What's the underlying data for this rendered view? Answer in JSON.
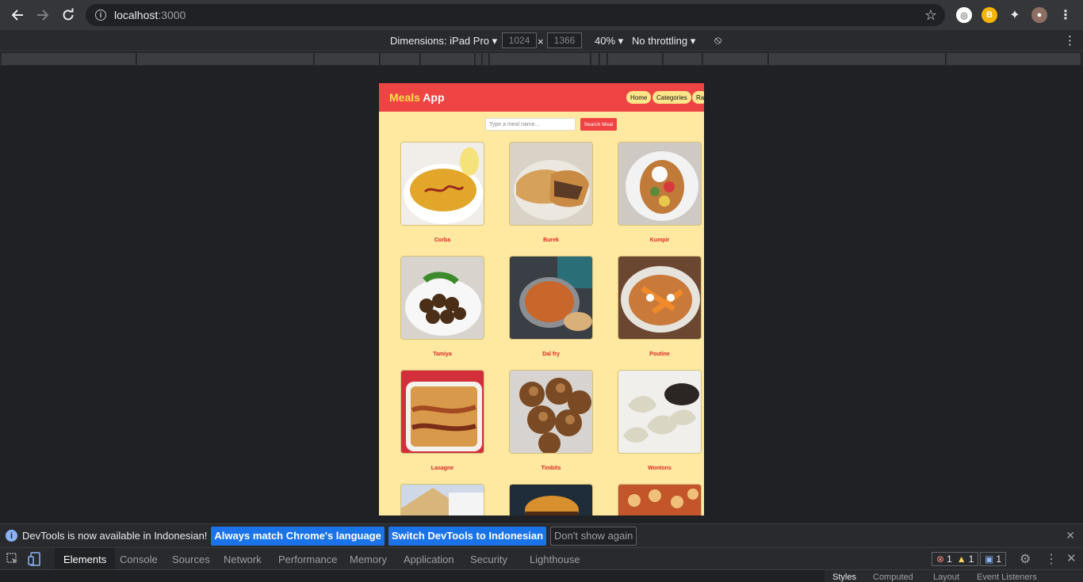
{
  "browser": {
    "url_host": "localhost",
    "url_port": ":3000"
  },
  "device_toolbar": {
    "dimensions_label": "Dimensions: iPad Pro",
    "width": "1024",
    "times": "×",
    "height": "1366",
    "zoom": "40%",
    "throttling": "No throttling"
  },
  "app": {
    "logo_part1": "Meals",
    "logo_part2": "App",
    "nav": [
      "Home",
      "Categories",
      "Ran"
    ],
    "search_placeholder": "Type a meal name...",
    "search_button": "Search Meal",
    "meals": [
      {
        "name": "Corba"
      },
      {
        "name": "Burek"
      },
      {
        "name": "Kumpir"
      },
      {
        "name": "Tamiya"
      },
      {
        "name": "Dal fry"
      },
      {
        "name": "Poutine"
      },
      {
        "name": "Lasagne"
      },
      {
        "name": "Timbits"
      },
      {
        "name": "Wontons"
      }
    ]
  },
  "devtools": {
    "info_message": "DevTools is now available in Indonesian!",
    "btn_match": "Always match Chrome's language",
    "btn_switch": "Switch DevTools to Indonesian",
    "btn_dismiss": "Don't show again",
    "tabs": [
      "Elements",
      "Console",
      "Sources",
      "Network",
      "Performance",
      "Memory",
      "Application",
      "Security",
      "Lighthouse"
    ],
    "errors": "1",
    "warnings": "1",
    "messages": "1",
    "side_tabs": [
      "Styles",
      "Computed",
      "Layout",
      "Event Listeners"
    ]
  },
  "colors": {
    "app_header": "#ef4444",
    "app_bg": "#ffe8a0",
    "accent_blue": "#1a73e8"
  }
}
